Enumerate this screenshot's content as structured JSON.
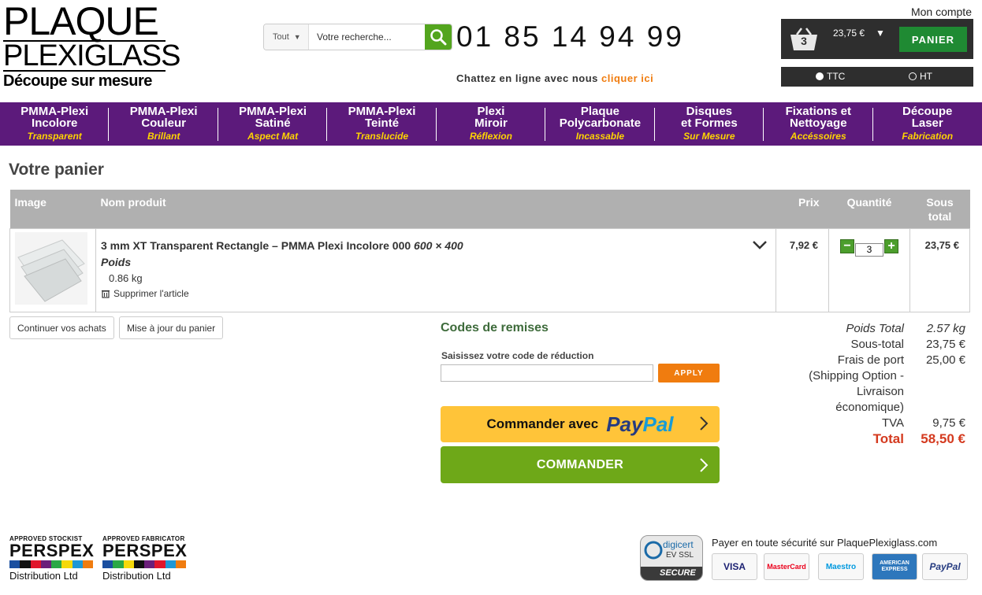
{
  "header": {
    "logo_line1": "PLAQUE",
    "logo_line2": "PLEXIGLASS",
    "logo_line3": "Découpe sur mesure",
    "search_category": "Tout",
    "search_placeholder": "Votre recherche...",
    "phone": "01 85 14 94 99",
    "chat_text": "Chattez en ligne avec nous",
    "chat_link": "cliquer ici",
    "account_label": "Mon compte",
    "cart_count": "3",
    "cart_amount": "23,75 €",
    "cart_button": "PANIER",
    "tax_options": [
      "TTC",
      "HT"
    ],
    "tax_selected": "TTC"
  },
  "nav": [
    {
      "title1": "PMMA-Plexi",
      "title2": "Incolore",
      "sub": "Transparent"
    },
    {
      "title1": "PMMA-Plexi",
      "title2": "Couleur",
      "sub": "Brillant"
    },
    {
      "title1": "PMMA-Plexi",
      "title2": "Satiné",
      "sub": "Aspect Mat"
    },
    {
      "title1": "PMMA-Plexi",
      "title2": "Teinté",
      "sub": "Translucide"
    },
    {
      "title1": "Plexi",
      "title2": "Miroir",
      "sub": "Réflexion"
    },
    {
      "title1": "Plaque",
      "title2": "Polycarbonate",
      "sub": "Incassable"
    },
    {
      "title1": "Disques",
      "title2": "et Formes",
      "sub": "Sur Mesure"
    },
    {
      "title1": "Fixations et",
      "title2": "Nettoyage",
      "sub": "Accéssoires"
    },
    {
      "title1": "Découpe",
      "title2": "Laser",
      "sub": "Fabrication"
    }
  ],
  "cart": {
    "title": "Votre panier",
    "columns": {
      "image": "Image",
      "name": "Nom produit",
      "price": "Prix",
      "qty": "Quantité",
      "subtotal_1": "Sous",
      "subtotal_2": "total"
    },
    "item": {
      "name": "3 mm XT Transparent Rectangle – PMMA Plexi Incolore 000",
      "dims": "600 × 400",
      "weight_label": "Poids",
      "weight_value": "0.86 kg",
      "remove": "Supprimer l'article",
      "price": "7,92 €",
      "qty": "3",
      "subtotal": "23,75 €"
    },
    "continue_btn": "Continuer vos achats",
    "update_btn": "Mise à jour du panier"
  },
  "discount": {
    "title": "Codes de remises",
    "label": "Saisissez votre code de réduction",
    "apply": "APPLY"
  },
  "checkout": {
    "paypal_prefix": "Commander avec",
    "paypal_word1": "Pay",
    "paypal_word2": "Pal",
    "commander": "COMMANDER"
  },
  "totals": {
    "weight_label": "Poids Total",
    "weight_value": "2.57 kg",
    "subtotal_label": "Sous-total",
    "subtotal_value": "23,75 €",
    "shipping_label": "Frais de port",
    "shipping_value": "25,00 €",
    "shipping_note1": "(Shipping Option -",
    "shipping_note2": "Livraison",
    "shipping_note3": "économique)",
    "tva_label": "TVA",
    "tva_value": "9,75 €",
    "total_label": "Total",
    "total_value": "58,50 €"
  },
  "footer": {
    "perspex1": {
      "top": "APPROVED STOCKIST",
      "brand": "PERSPEX",
      "bottom": "Distribution Ltd"
    },
    "perspex2": {
      "top": "APPROVED FABRICATOR",
      "brand": "PERSPEX",
      "bottom": "Distribution Ltd"
    },
    "digicert": {
      "name": "digicert",
      "type": "EV SSL",
      "secure": "SECURE"
    },
    "pay_title": "Payer en toute sécurité sur PlaquePlexiglass.com",
    "cards": [
      "VISA",
      "MasterCard",
      "Maestro",
      "AMERICAN EXPRESS",
      "PayPal"
    ]
  },
  "colors": {
    "nav_bg": "#5c1a7b",
    "nav_sub": "#ffd400",
    "accent_orange": "#f07c0f",
    "green": "#6ea818",
    "total_red": "#d43a1f"
  }
}
